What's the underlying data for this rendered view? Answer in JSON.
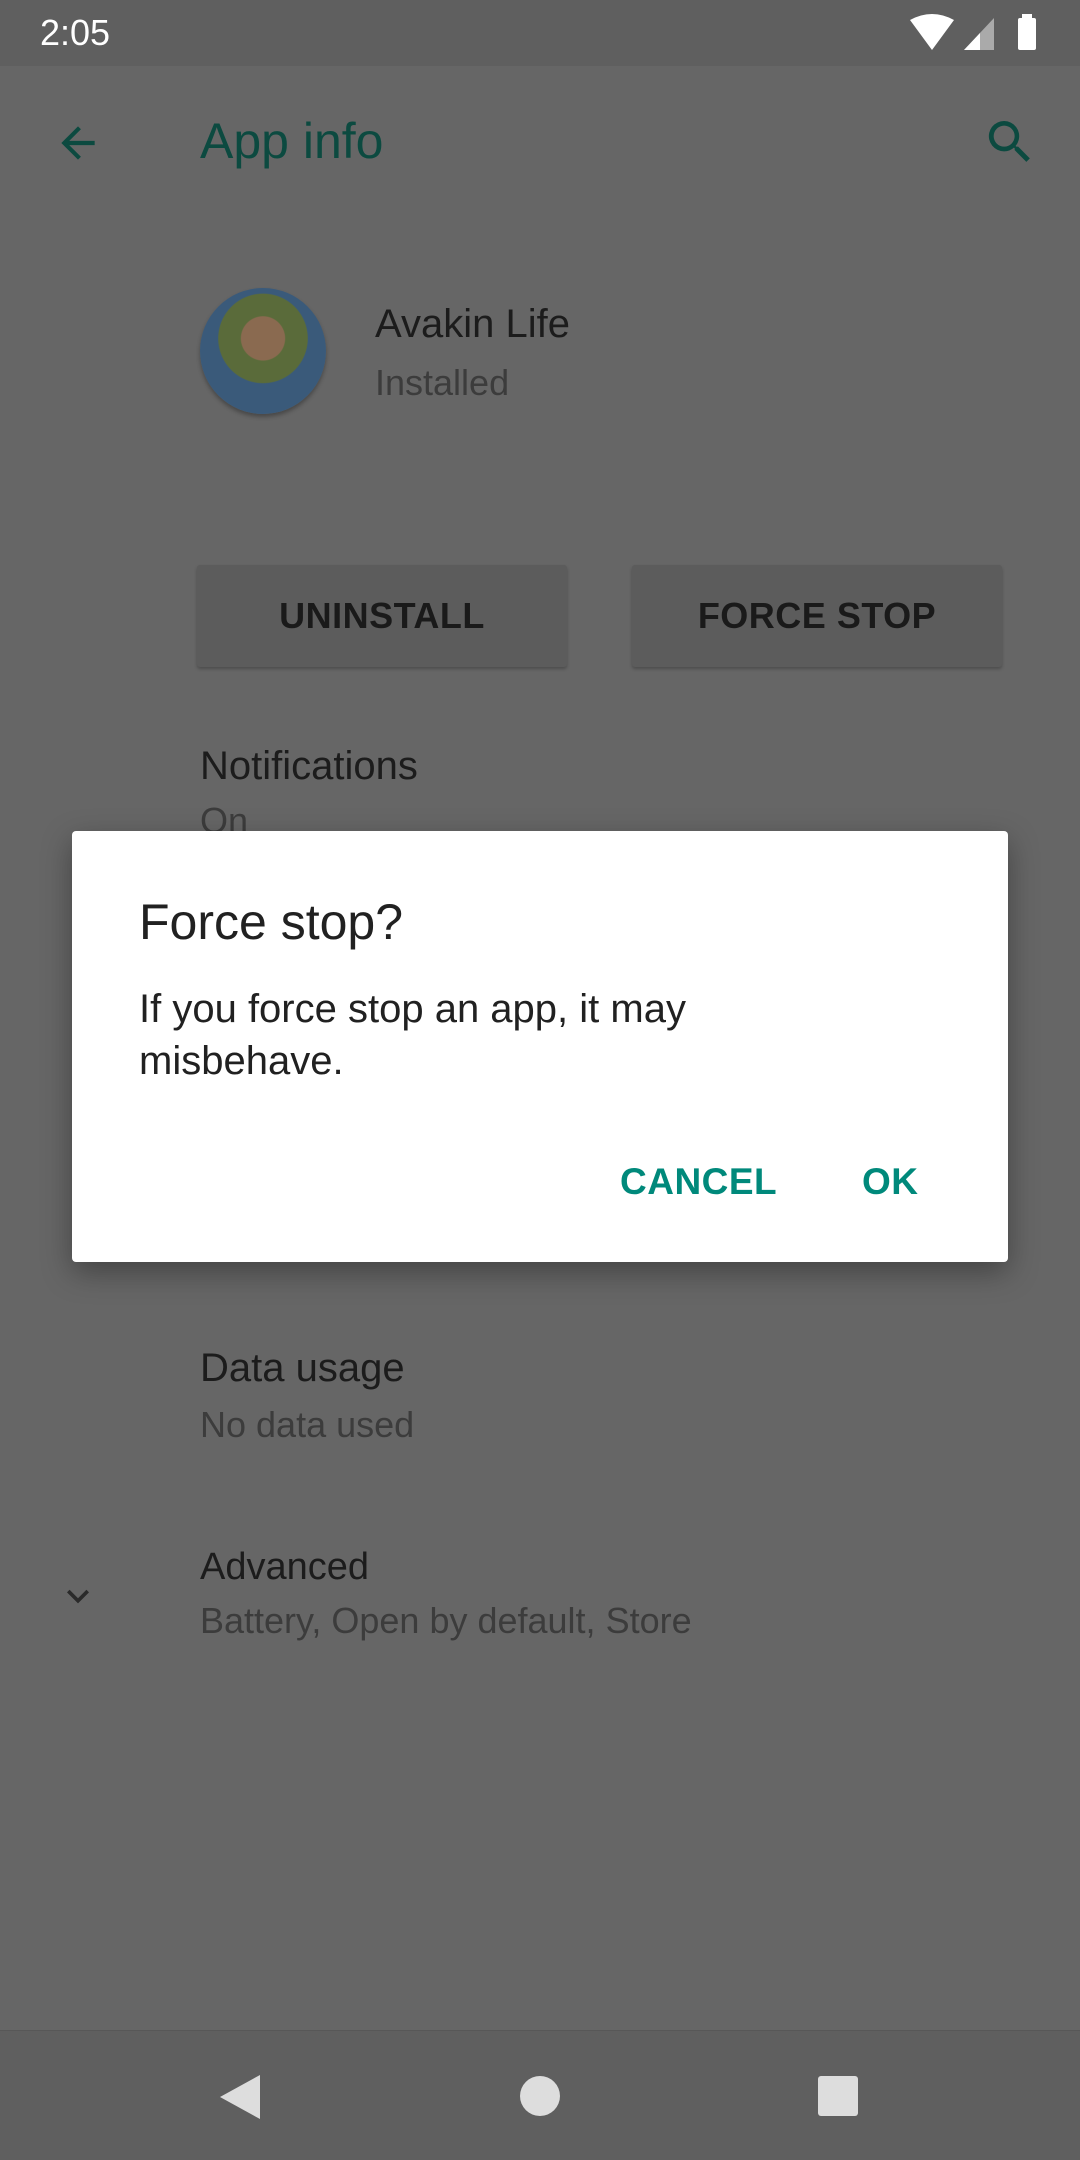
{
  "status_bar": {
    "time": "2:05",
    "icons": [
      "wifi-icon",
      "signal-icon",
      "battery-icon"
    ]
  },
  "toolbar": {
    "title": "App info",
    "back_icon": "arrow-back-icon",
    "search_icon": "search-icon"
  },
  "app": {
    "name": "Avakin Life",
    "status": "Installed"
  },
  "actions": {
    "uninstall": "UNINSTALL",
    "force_stop": "FORCE STOP"
  },
  "settings": [
    {
      "title": "Notifications",
      "subtitle": "On"
    },
    {
      "title": "Data usage",
      "subtitle": "No data used"
    },
    {
      "title": "Advanced",
      "subtitle": "Battery, Open by default, Store"
    }
  ],
  "dialog": {
    "title": "Force stop?",
    "message": "If you force stop an app, it may misbehave.",
    "cancel": "CANCEL",
    "ok": "OK"
  },
  "colors": {
    "accent": "#00897b"
  }
}
